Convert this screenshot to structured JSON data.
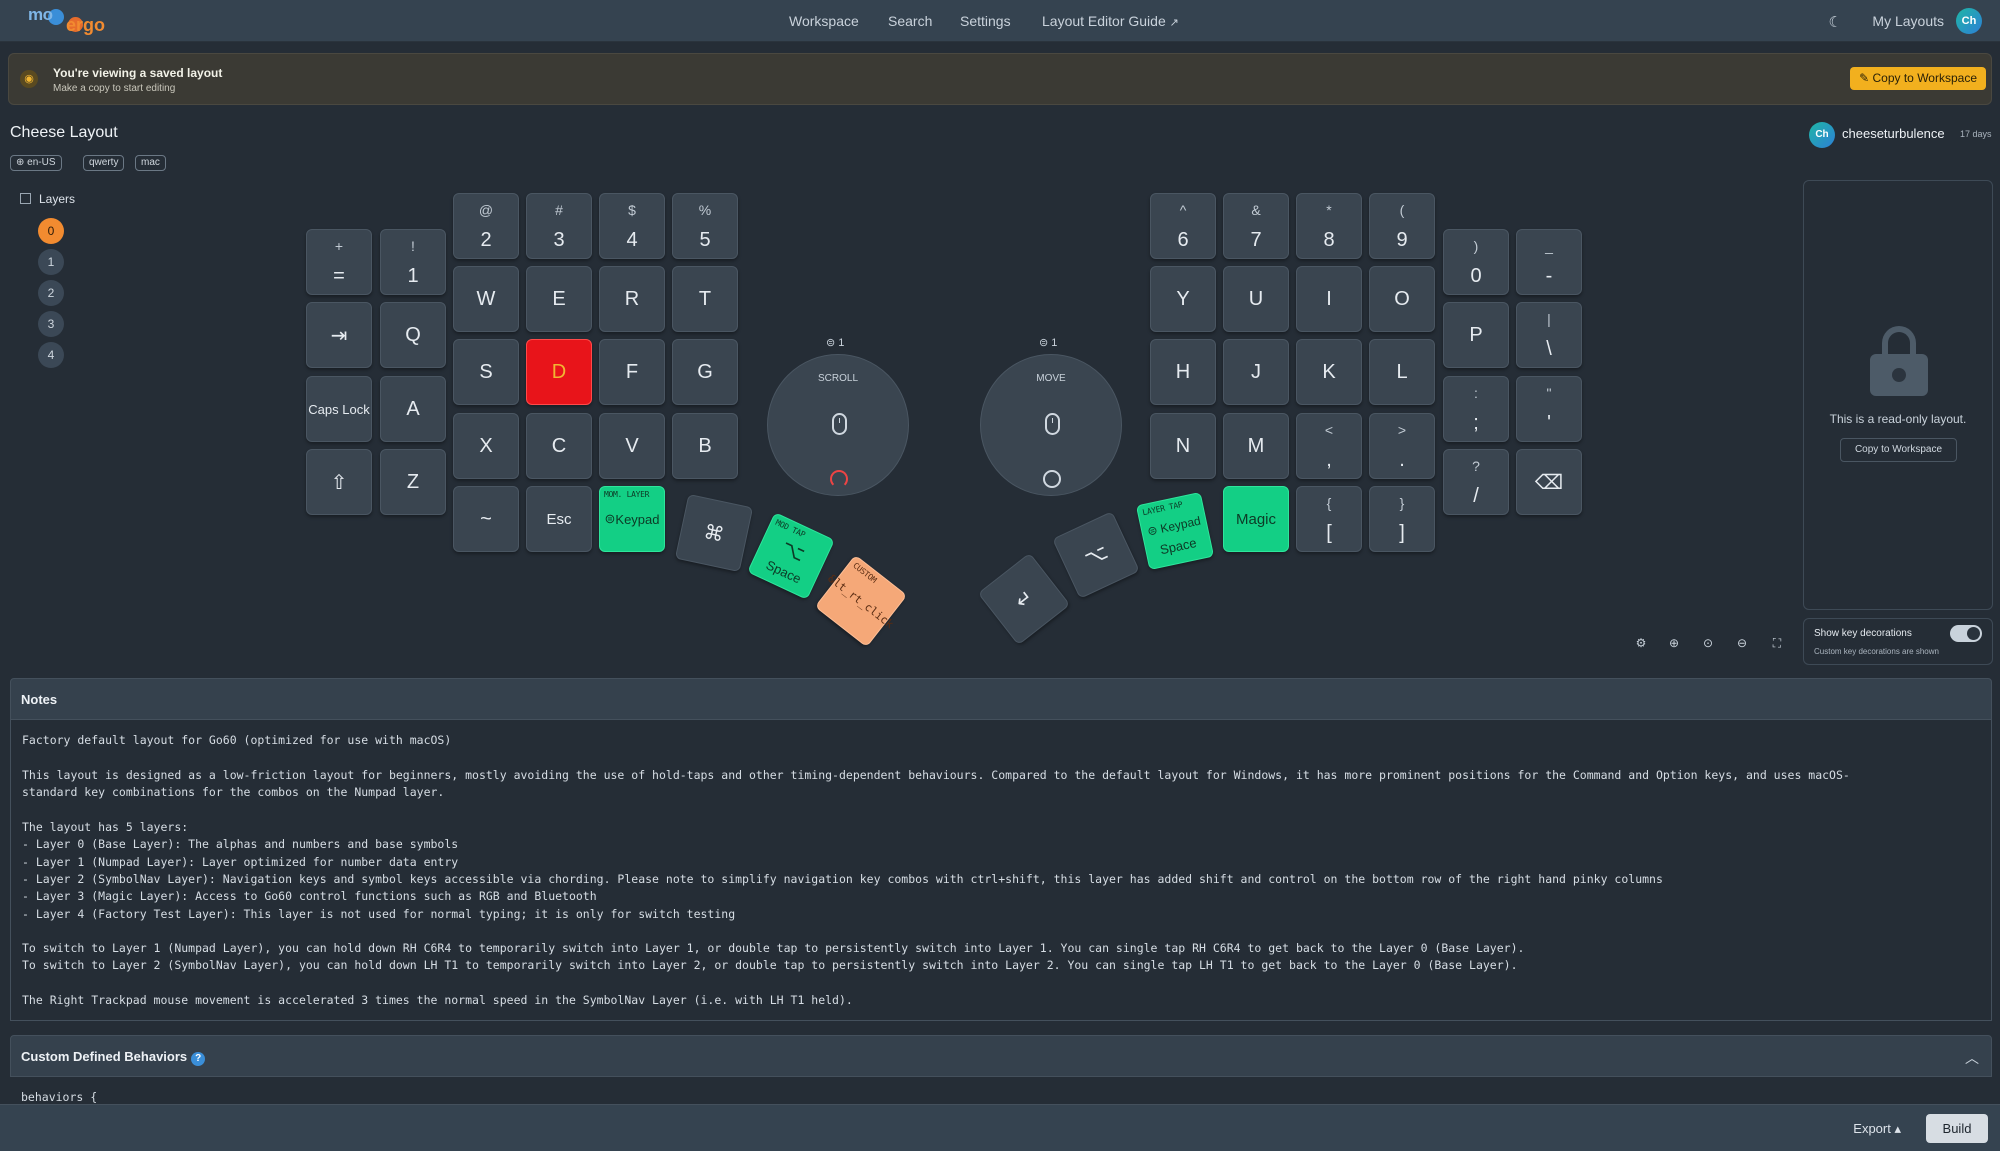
{
  "nav": {
    "logo_left": "mo",
    "logo_right": "ergo",
    "links": [
      "Workspace",
      "Search",
      "Settings",
      "Layout Editor Guide"
    ],
    "my_layouts": "My Layouts",
    "avatar": "Ch"
  },
  "banner": {
    "title": "You're viewing a saved layout",
    "subtitle": "Make a copy to start editing",
    "button": "Copy to Workspace"
  },
  "layout": {
    "title": "Cheese Layout",
    "tags": [
      "en-US",
      "qwerty",
      "mac"
    ],
    "owner": "cheeseturbulence",
    "owner_time": "17 days",
    "owner_avatar": "Ch"
  },
  "layers": {
    "heading": "Layers",
    "items": [
      "0",
      "1",
      "2",
      "3",
      "4"
    ],
    "active": "0"
  },
  "keys": {
    "eq": {
      "top": "+",
      "main": "="
    },
    "k1": {
      "top": "!",
      "main": "1"
    },
    "k2": {
      "top": "@",
      "main": "2"
    },
    "k3": {
      "top": "#",
      "main": "3"
    },
    "k4": {
      "top": "$",
      "main": "4"
    },
    "k5": {
      "top": "%",
      "main": "5"
    },
    "tab": "⇥",
    "q": "Q",
    "w": "W",
    "e": "E",
    "r": "R",
    "t": "T",
    "caps": "Caps Lock",
    "a": "A",
    "s": "S",
    "d": "D",
    "f": "F",
    "g": "G",
    "shift": "⇧",
    "z": "Z",
    "x": "X",
    "c": "C",
    "v": "V",
    "b": "B",
    "tilde": "~",
    "esc": "Esc",
    "keypad": {
      "label": "MOM. LAYER",
      "main": "Keypad"
    },
    "cmd": "⌘",
    "modtap": {
      "label": "MOD TAP",
      "main": "⌥",
      "sub": "Space"
    },
    "custom": {
      "label": "CUSTOM",
      "main": "&lt_rt_click"
    },
    "k6": {
      "top": "^",
      "main": "6"
    },
    "k7": {
      "top": "&",
      "main": "7"
    },
    "k8": {
      "top": "*",
      "main": "8"
    },
    "k9": {
      "top": "(",
      "main": "9"
    },
    "k0": {
      "top": ")",
      "main": "0"
    },
    "minus": {
      "top": "_",
      "main": "-"
    },
    "y": "Y",
    "u": "U",
    "i": "I",
    "o": "O",
    "p": "P",
    "bslash": {
      "top": "|",
      "main": "\\"
    },
    "h": "H",
    "j": "J",
    "k": "K",
    "l": "L",
    "semi": {
      "top": ":",
      "main": ";"
    },
    "quote": {
      "top": "\"",
      "main": "'"
    },
    "n": "N",
    "m": "M",
    "comma": {
      "top": "<",
      "main": ","
    },
    "period": {
      "top": ">",
      "main": "."
    },
    "slash": {
      "top": "?",
      "main": "/"
    },
    "bksp": "⌫",
    "magic": "Magic",
    "lbrack": {
      "top": "{",
      "main": "["
    },
    "rbrack": {
      "top": "}",
      "main": "]"
    },
    "layertap": {
      "label": "LAYER TAP",
      "main": "Keypad",
      "sub": "Space"
    },
    "opt": "⌥",
    "enter": "↵"
  },
  "trackballs": {
    "left": {
      "count": "1",
      "label": "SCROLL"
    },
    "right": {
      "count": "1",
      "label": "MOVE"
    }
  },
  "readonly": {
    "text": "This is a read-only layout.",
    "button": "Copy to Workspace"
  },
  "decorations": {
    "title": "Show key decorations",
    "subtitle": "Custom key decorations are shown",
    "enabled": true
  },
  "notes": {
    "heading": "Notes",
    "lines": [
      "Factory default layout for Go60 (optimized for use with macOS)",
      "",
      "This layout is designed as a low-friction layout for beginners, mostly avoiding the use of hold-taps and other timing-dependent behaviours. Compared to the default layout for Windows, it has more prominent positions for the Command and Option keys, and uses macOS-",
      "standard key combinations for the combos on the Numpad layer.",
      "",
      "The layout has 5 layers:",
      "- Layer 0 (Base Layer): The alphas and numbers and base symbols",
      "- Layer 1 (Numpad Layer): Layer optimized for number data entry",
      "- Layer 2 (SymbolNav Layer): Navigation keys and symbol keys accessible via chording. Please note to simplify navigation key combos with ctrl+shift, this layer has added shift and control on the bottom row of the right hand pinky columns",
      "- Layer 3 (Magic Layer): Access to Go60 control functions such as RGB and Bluetooth",
      "- Layer 4 (Factory Test Layer): This layer is not used for normal typing; it is only for switch testing",
      "",
      "To switch to Layer 1 (Numpad Layer), you can hold down RH C6R4 to temporarily switch into Layer 1, or double tap to persistently switch into Layer 1. You can single tap RH C6R4 to get back to the Layer 0 (Base Layer).",
      "To switch to Layer 2 (SymbolNav Layer), you can hold down LH T1 to temporarily switch into Layer 2, or double tap to persistently switch into Layer 2. You can single tap LH T1 to get back to the Layer 0 (Base Layer).",
      "",
      "The Right Trackpad mouse movement is accelerated 3 times the normal speed in the SymbolNav Layer (i.e. with LH T1 held)."
    ]
  },
  "behaviors": {
    "heading": "Custom Defined Behaviors",
    "help": "?",
    "code": "behaviors {"
  },
  "bottom": {
    "export": "Export ▴",
    "build": "Build"
  }
}
